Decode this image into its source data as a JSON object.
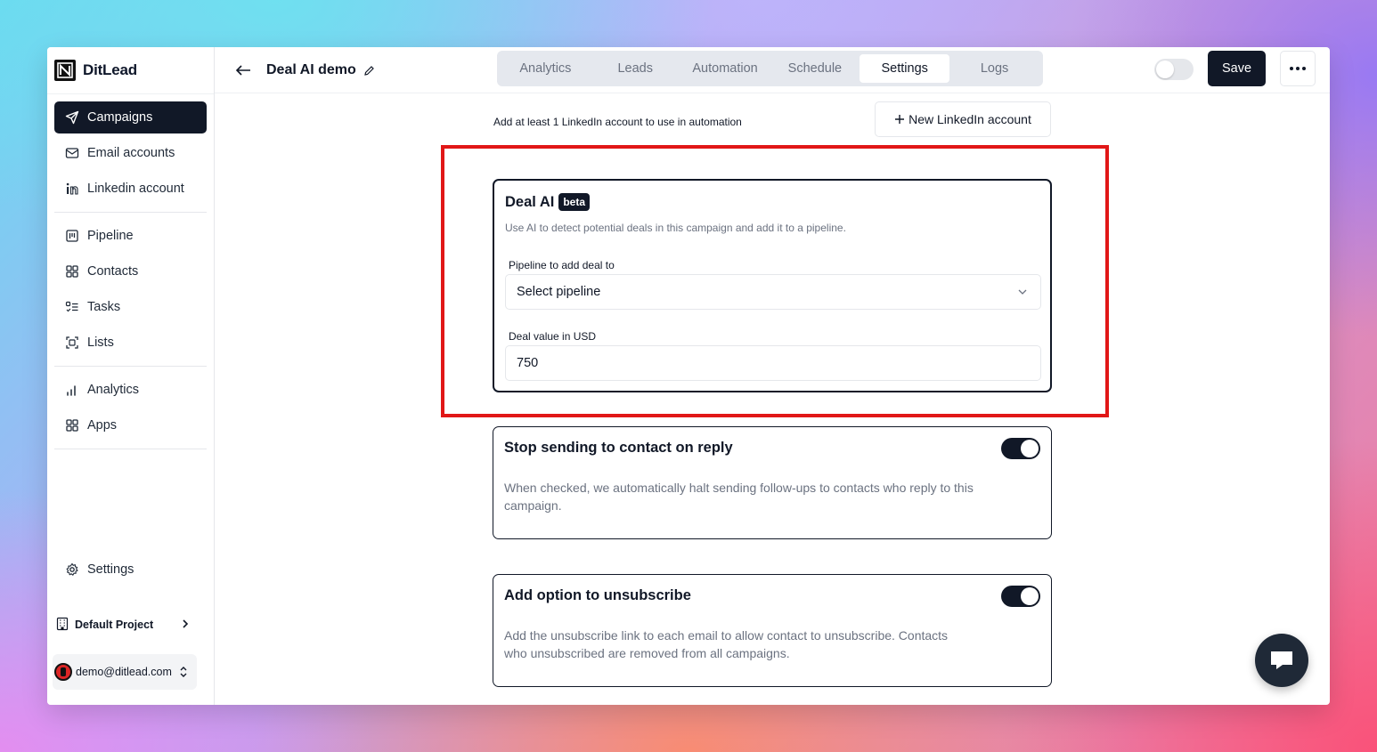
{
  "app": {
    "name": "DitLead"
  },
  "sidebar": {
    "items": [
      {
        "label": "Campaigns",
        "icon": "send-icon",
        "active": true
      },
      {
        "label": "Email accounts",
        "icon": "mail-icon"
      },
      {
        "label": "Linkedin account",
        "icon": "linkedin-icon"
      },
      {
        "label": "Pipeline",
        "icon": "kanban-icon"
      },
      {
        "label": "Contacts",
        "icon": "grid-icon"
      },
      {
        "label": "Tasks",
        "icon": "list-check-icon"
      },
      {
        "label": "Lists",
        "icon": "scan-icon"
      },
      {
        "label": "Analytics",
        "icon": "bar-chart-icon"
      },
      {
        "label": "Apps",
        "icon": "apps-grid-icon"
      }
    ],
    "settings_label": "Settings",
    "project_label": "Default Project",
    "user_email": "demo@ditlead.com"
  },
  "header": {
    "title": "Deal AI demo",
    "tabs": [
      "Analytics",
      "Leads",
      "Automation",
      "Schedule",
      "Settings",
      "Logs"
    ],
    "active_tab": "Settings",
    "save_label": "Save",
    "campaign_active": false
  },
  "main": {
    "linkedin_hint": "Add at least 1 LinkedIn account to use in automation",
    "new_linkedin_label": "New LinkedIn account",
    "deal_ai": {
      "title": "Deal AI",
      "badge": "beta",
      "subtitle": "Use AI to detect potential deals in this campaign and add it to a pipeline.",
      "pipeline_label": "Pipeline to add deal to",
      "pipeline_value": "Select pipeline",
      "value_label": "Deal value in USD",
      "value": "750"
    },
    "stop_on_reply": {
      "title": "Stop sending to contact on reply",
      "enabled": true,
      "description": "When checked, we automatically halt sending follow-ups to contacts who reply to this campaign."
    },
    "unsubscribe": {
      "title": "Add option to unsubscribe",
      "enabled": true,
      "description": "Add the unsubscribe link to each email to allow contact to unsubscribe. Contacts who unsubscribed are removed from all campaigns."
    }
  },
  "colors": {
    "primary": "#111827",
    "highlight": "#e11717",
    "muted_text": "#6b7280"
  }
}
